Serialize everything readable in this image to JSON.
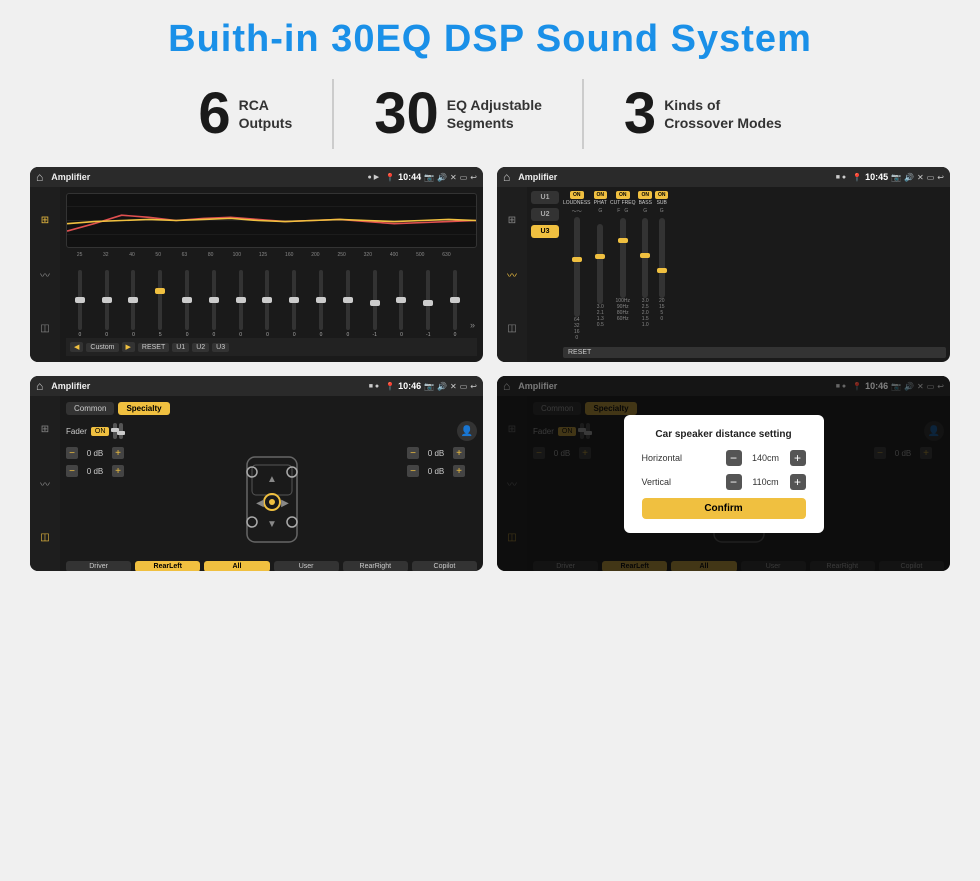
{
  "title": "Buith-in 30EQ DSP Sound System",
  "stats": [
    {
      "number": "6",
      "label_line1": "RCA",
      "label_line2": "Outputs"
    },
    {
      "number": "30",
      "label_line1": "EQ Adjustable",
      "label_line2": "Segments"
    },
    {
      "number": "3",
      "label_line1": "Kinds of",
      "label_line2": "Crossover Modes"
    }
  ],
  "screens": [
    {
      "id": "eq-screen",
      "statusbar": {
        "title": "Amplifier",
        "time": "10:44"
      },
      "type": "eq"
    },
    {
      "id": "crossover-screen",
      "statusbar": {
        "title": "Amplifier",
        "time": "10:45"
      },
      "type": "crossover"
    },
    {
      "id": "fader-screen",
      "statusbar": {
        "title": "Amplifier",
        "time": "10:46"
      },
      "type": "fader"
    },
    {
      "id": "dialog-screen",
      "statusbar": {
        "title": "Amplifier",
        "time": "10:46"
      },
      "type": "dialog"
    }
  ],
  "eq": {
    "freq_labels": [
      "25",
      "32",
      "40",
      "50",
      "63",
      "80",
      "100",
      "125",
      "160",
      "200",
      "250",
      "320",
      "400",
      "500",
      "630"
    ],
    "values": [
      "0",
      "0",
      "0",
      "5",
      "0",
      "0",
      "0",
      "0",
      "0",
      "0",
      "0",
      "-1",
      "0",
      "-1"
    ],
    "bottom_buttons": [
      "◀",
      "Custom",
      "▶",
      "RESET",
      "U1",
      "U2",
      "U3"
    ]
  },
  "crossover": {
    "presets": [
      "U1",
      "U2",
      "U3"
    ],
    "channels": [
      {
        "label": "LOUDNESS",
        "on": true
      },
      {
        "label": "PHAT",
        "on": true
      },
      {
        "label": "CUT FREQ",
        "on": true
      },
      {
        "label": "BASS",
        "on": true
      },
      {
        "label": "SUB",
        "on": true
      }
    ],
    "reset_label": "RESET"
  },
  "fader": {
    "tabs": [
      "Common",
      "Specialty"
    ],
    "active_tab": "Specialty",
    "fader_label": "Fader",
    "fader_on": "ON",
    "left_channels": [
      {
        "value": "0 dB"
      },
      {
        "value": "0 dB"
      }
    ],
    "right_channels": [
      {
        "value": "0 dB"
      },
      {
        "value": "0 dB"
      }
    ],
    "bottom_buttons": [
      "Driver",
      "RearLeft",
      "All",
      "User",
      "RearRight",
      "Copilot"
    ]
  },
  "dialog": {
    "title": "Car speaker distance setting",
    "horizontal_label": "Horizontal",
    "horizontal_value": "140cm",
    "vertical_label": "Vertical",
    "vertical_value": "110cm",
    "confirm_label": "Confirm",
    "left_channel_value": "0 dB",
    "right_channel_value": "0 dB"
  }
}
